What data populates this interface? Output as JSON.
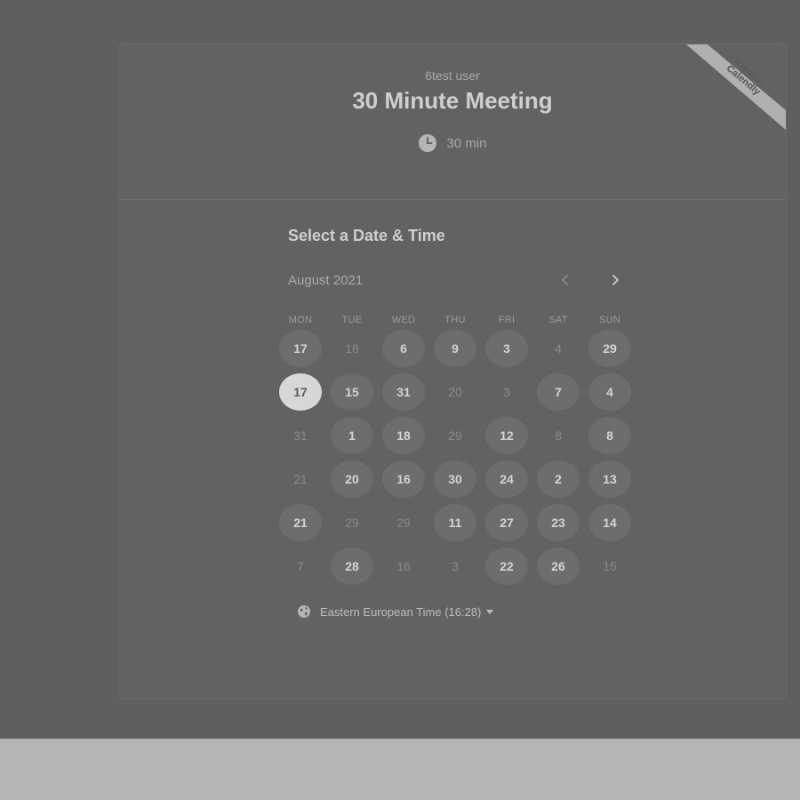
{
  "event": {
    "organizer": "6test user",
    "title": "30 Minute Meeting",
    "duration": "30 min"
  },
  "badge": {
    "line1": "POWERED BY",
    "line2": "Calendly"
  },
  "calendar": {
    "section_title": "Select a Date & Time",
    "month_label": "August 2021",
    "weekdays": [
      "MON",
      "TUE",
      "WED",
      "THU",
      "FRI",
      "SAT",
      "SUN"
    ],
    "weeks": [
      [
        {
          "label": "17",
          "state": "available"
        },
        {
          "label": "18",
          "state": "disabled"
        },
        {
          "label": "6",
          "state": "available"
        },
        {
          "label": "9",
          "state": "available"
        },
        {
          "label": "3",
          "state": "available"
        },
        {
          "label": "4",
          "state": "disabled"
        },
        {
          "label": "29",
          "state": "available"
        }
      ],
      [
        {
          "label": "17",
          "state": "selected"
        },
        {
          "label": "15",
          "state": "available"
        },
        {
          "label": "31",
          "state": "available"
        },
        {
          "label": "20",
          "state": "disabled"
        },
        {
          "label": "3",
          "state": "disabled"
        },
        {
          "label": "7",
          "state": "available"
        },
        {
          "label": "4",
          "state": "available"
        }
      ],
      [
        {
          "label": "31",
          "state": "disabled"
        },
        {
          "label": "1",
          "state": "available"
        },
        {
          "label": "18",
          "state": "available"
        },
        {
          "label": "29",
          "state": "disabled"
        },
        {
          "label": "12",
          "state": "available"
        },
        {
          "label": "8",
          "state": "disabled"
        },
        {
          "label": "8",
          "state": "available"
        }
      ],
      [
        {
          "label": "21",
          "state": "disabled"
        },
        {
          "label": "20",
          "state": "available"
        },
        {
          "label": "16",
          "state": "available"
        },
        {
          "label": "30",
          "state": "available"
        },
        {
          "label": "24",
          "state": "available"
        },
        {
          "label": "2",
          "state": "available"
        },
        {
          "label": "13",
          "state": "available"
        }
      ],
      [
        {
          "label": "21",
          "state": "available"
        },
        {
          "label": "29",
          "state": "disabled"
        },
        {
          "label": "29",
          "state": "disabled"
        },
        {
          "label": "11",
          "state": "available"
        },
        {
          "label": "27",
          "state": "available"
        },
        {
          "label": "23",
          "state": "available"
        },
        {
          "label": "14",
          "state": "available"
        }
      ],
      [
        {
          "label": "7",
          "state": "disabled"
        },
        {
          "label": "28",
          "state": "available"
        },
        {
          "label": "16",
          "state": "disabled"
        },
        {
          "label": "3",
          "state": "disabled"
        },
        {
          "label": "22",
          "state": "available"
        },
        {
          "label": "26",
          "state": "available"
        },
        {
          "label": "15",
          "state": "disabled"
        }
      ]
    ]
  },
  "timezone": {
    "label": "Eastern European Time (16:28)"
  },
  "icons": {
    "duration": "clock-icon",
    "timezone": "globe-icon",
    "prev": "chevron-left-icon",
    "next": "chevron-right-icon",
    "timezone_dropdown": "caret-down-icon"
  }
}
